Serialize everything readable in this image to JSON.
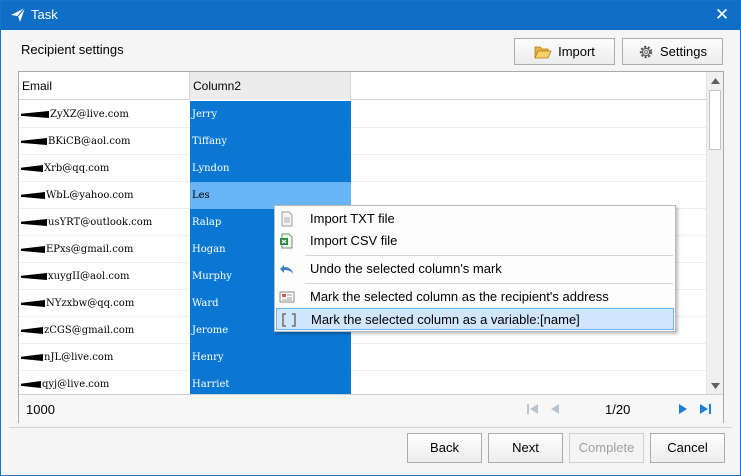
{
  "window": {
    "title": "Task"
  },
  "section_title": "Recipient settings",
  "toolbar": {
    "import_label": "Import",
    "settings_label": "Settings"
  },
  "grid": {
    "columns": [
      "Email",
      "Column2"
    ],
    "rows": [
      {
        "email": "ZyXZ@live.com",
        "name": "Jerry"
      },
      {
        "email": "BKiCB@aol.com",
        "name": "Tiffany"
      },
      {
        "email": "Xrb@qq.com",
        "name": "Lyndon"
      },
      {
        "email": "WbL@yahoo.com",
        "name": "Les"
      },
      {
        "email": "usYRT@outlook.com",
        "name": "Ralap"
      },
      {
        "email": "EPxs@gmail.com",
        "name": "Hogan"
      },
      {
        "email": "xuygII@aol.com",
        "name": "Murphy"
      },
      {
        "email": "NYzxbw@qq.com",
        "name": "Ward"
      },
      {
        "email": "zCGS@gmail.com",
        "name": "Jerome"
      },
      {
        "email": "nJL@live.com",
        "name": "Henry"
      },
      {
        "email": "qyj@live.com",
        "name": "Harriet"
      }
    ],
    "total_count": "1000",
    "page_indicator": "1/20"
  },
  "context_menu": {
    "items": [
      "Import TXT file",
      "Import CSV file",
      "Undo the selected column's mark",
      "Mark the selected column as the recipient's address",
      "Mark the selected column as a variable:[name]"
    ]
  },
  "buttons": {
    "back": "Back",
    "next": "Next",
    "complete": "Complete",
    "cancel": "Cancel"
  },
  "colors": {
    "title_bar": "#0f6fc6",
    "selected_column": "#0a78d2",
    "highlight_cell": "#69b4f5",
    "menu_selection": "#cfe6fc"
  }
}
